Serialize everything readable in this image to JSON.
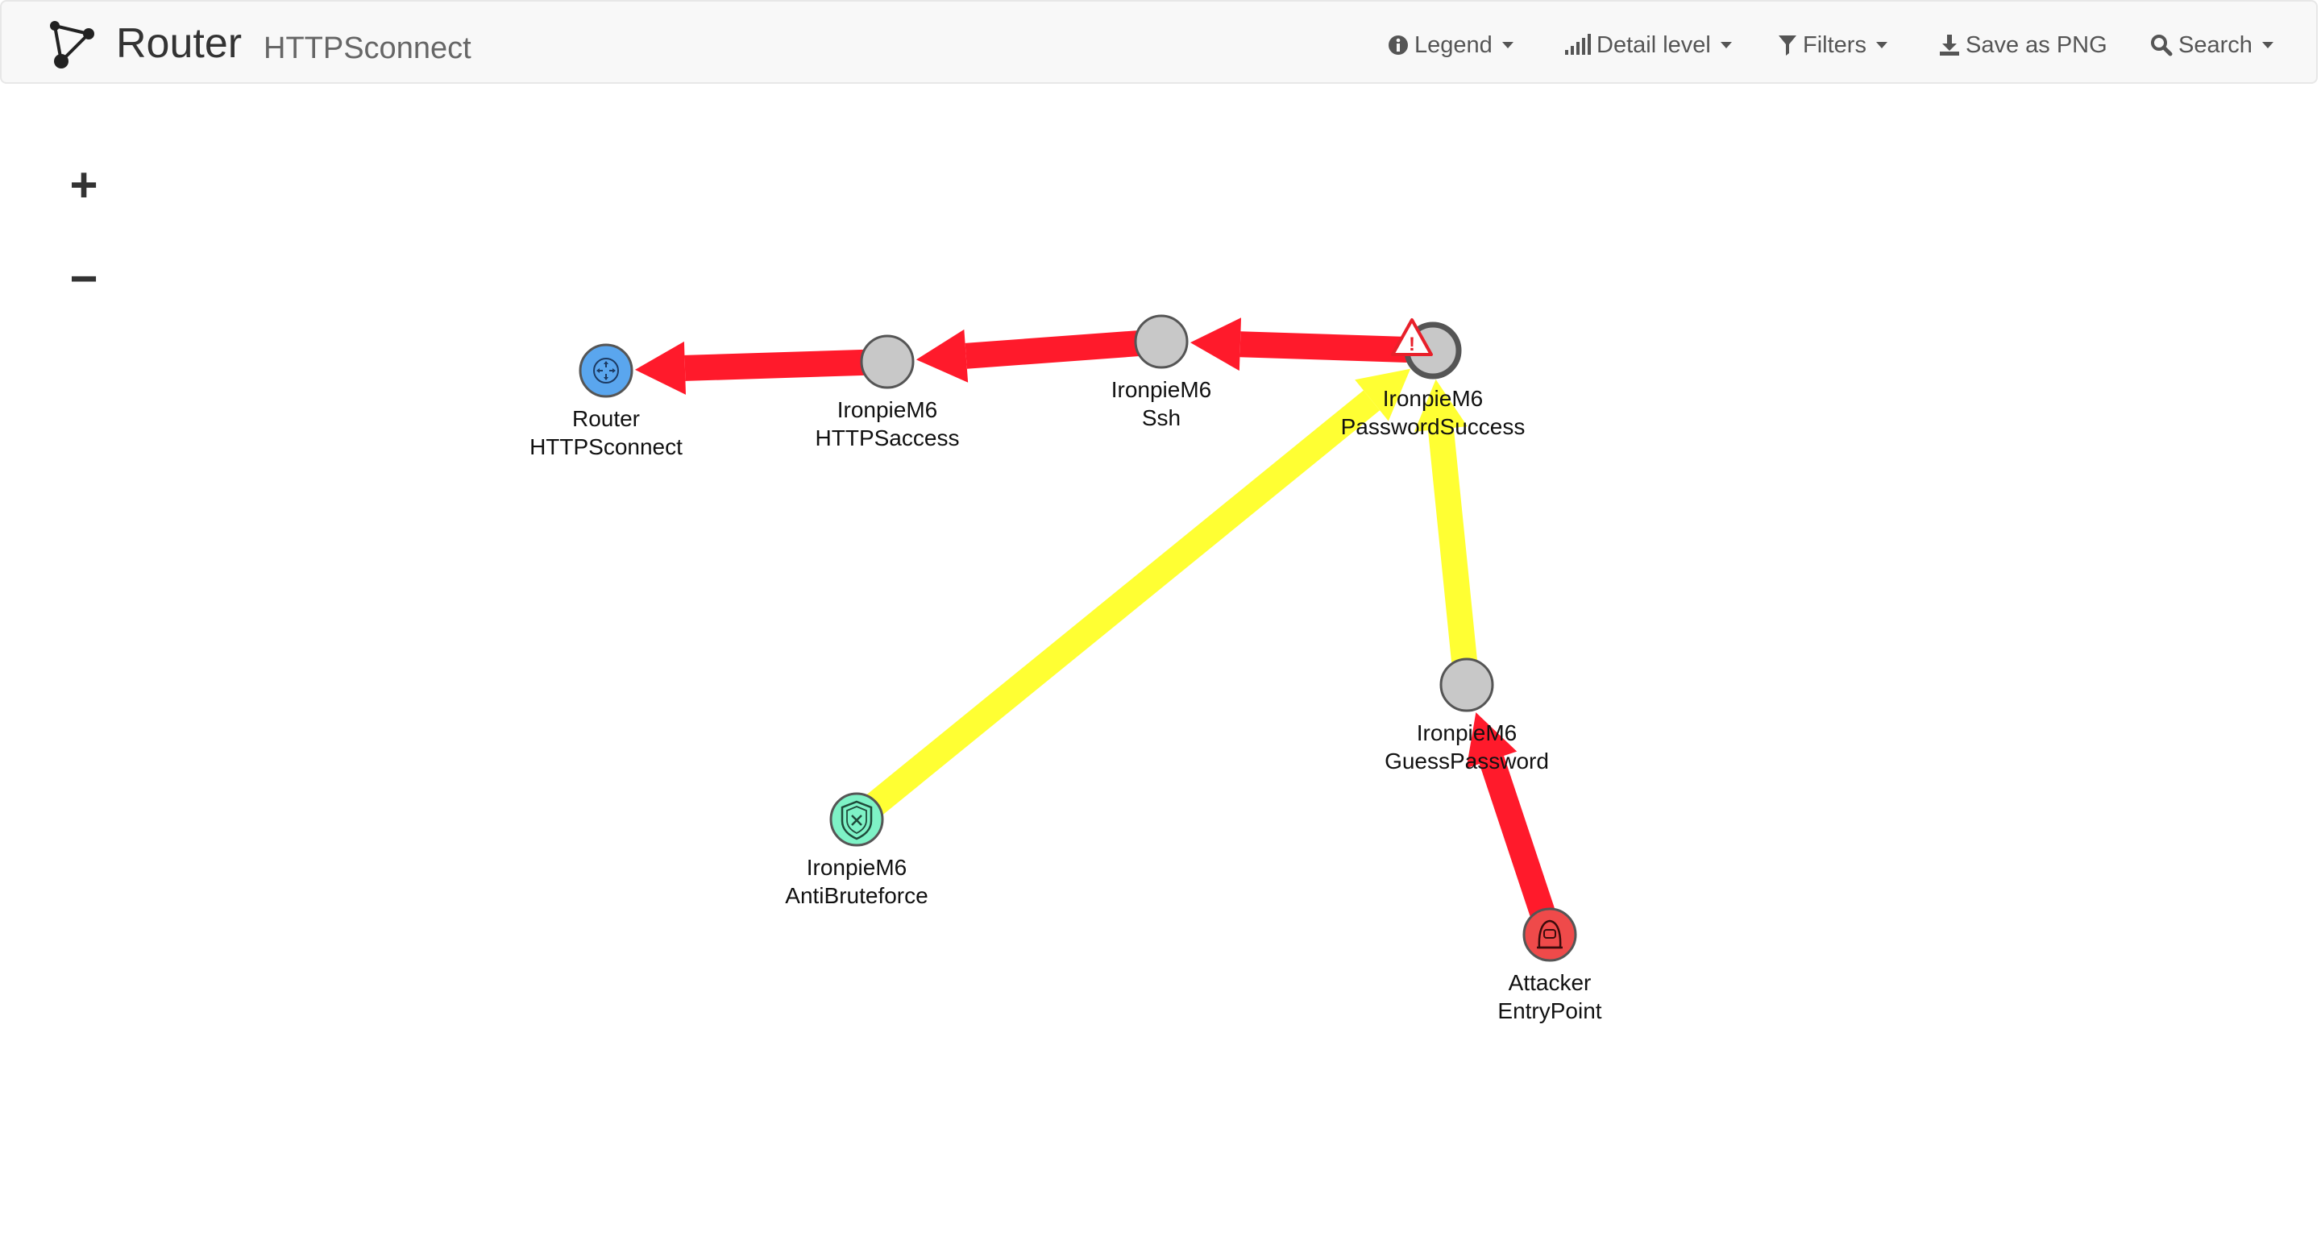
{
  "header": {
    "title": "Router",
    "subtitle": "HTTPSconnect"
  },
  "nav": {
    "legend": "Legend",
    "detail_level": "Detail level",
    "filters": "Filters",
    "save_png": "Save as PNG",
    "search": "Search"
  },
  "zoom": {
    "in_label": "+",
    "out_label": "−"
  },
  "colors": {
    "edge_red": "#ff1a2b",
    "edge_yellow": "#ffff33",
    "node_gray": "#c8c8c8",
    "node_router": "#5aa6ee",
    "node_defense": "#7ef2c6",
    "node_attacker": "#ef4a4a",
    "warning": "#e8202a"
  },
  "graph": {
    "nodes": [
      {
        "id": "router",
        "line1": "Router",
        "line2": "HTTPSconnect",
        "kind": "router",
        "icon": "router-icon"
      },
      {
        "id": "httpsaccess",
        "line1": "IronpieM6",
        "line2": "HTTPSaccess",
        "kind": "step"
      },
      {
        "id": "ssh",
        "line1": "IronpieM6",
        "line2": "Ssh",
        "kind": "step"
      },
      {
        "id": "pwsuccess",
        "line1": "IronpieM6",
        "line2": "PasswordSuccess",
        "kind": "step-warning",
        "icon": "warning-icon"
      },
      {
        "id": "guesspw",
        "line1": "IronpieM6",
        "line2": "GuessPassword",
        "kind": "step"
      },
      {
        "id": "antibrute",
        "line1": "IronpieM6",
        "line2": "AntiBruteforce",
        "kind": "defense",
        "icon": "shield-icon"
      },
      {
        "id": "attacker",
        "line1": "Attacker",
        "line2": "EntryPoint",
        "kind": "attacker",
        "icon": "hacker-icon"
      }
    ],
    "edges": [
      {
        "from": "httpsaccess",
        "to": "router",
        "color": "red"
      },
      {
        "from": "ssh",
        "to": "httpsaccess",
        "color": "red"
      },
      {
        "from": "pwsuccess",
        "to": "ssh",
        "color": "red"
      },
      {
        "from": "guesspw",
        "to": "pwsuccess",
        "color": "yellow"
      },
      {
        "from": "antibrute",
        "to": "pwsuccess",
        "color": "yellow"
      },
      {
        "from": "attacker",
        "to": "guesspw",
        "color": "red"
      }
    ]
  }
}
